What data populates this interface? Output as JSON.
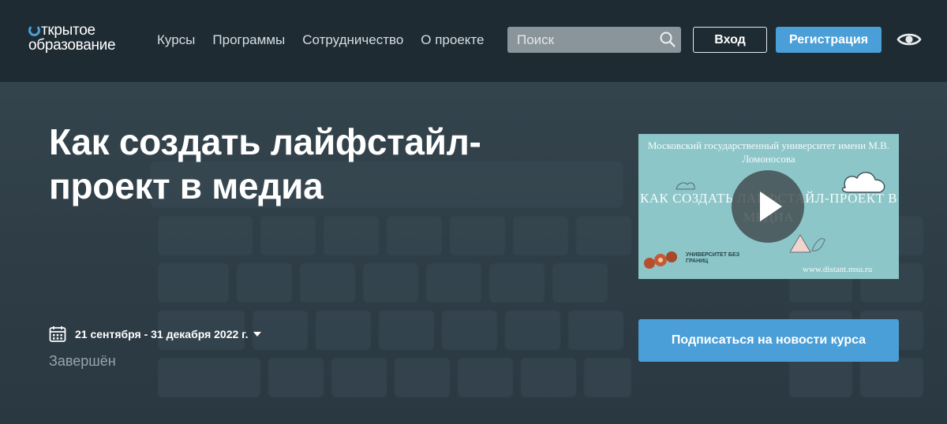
{
  "logo": {
    "line1": "ткрытое",
    "line2": "образование"
  },
  "nav": {
    "items": [
      "Курсы",
      "Программы",
      "Сотрудничество",
      "О проекте"
    ]
  },
  "search": {
    "placeholder": "Поиск"
  },
  "auth": {
    "login": "Вход",
    "register": "Регистрация"
  },
  "icons": {
    "search": "search-icon",
    "eye": "eye-icon",
    "calendar": "calendar-icon",
    "caret": "caret-down-icon",
    "play": "play-icon"
  },
  "colors": {
    "header_bg": "#1e2b33",
    "hero_bg": "#2b3a44",
    "accent": "#4a9fd8",
    "video_bg": "#8dc6c9"
  },
  "course": {
    "title": "Как создать лайфстайл-проект в медиа",
    "dates": "21 сентября - 31 декабря 2022 г.",
    "status": "Завершён",
    "subscribe": "Подписаться на новости курса"
  },
  "video": {
    "university": "Московский государственный университет имени М.В. Ломоносова",
    "title": "КАК СОЗДАТЬ ЛАЙФСТАЙЛ-ПРОЕКТ В МЕДИА",
    "brand": "УНИВЕРСИТЕТ БЕЗ ГРАНИЦ",
    "site": "www.distant.msu.ru"
  }
}
